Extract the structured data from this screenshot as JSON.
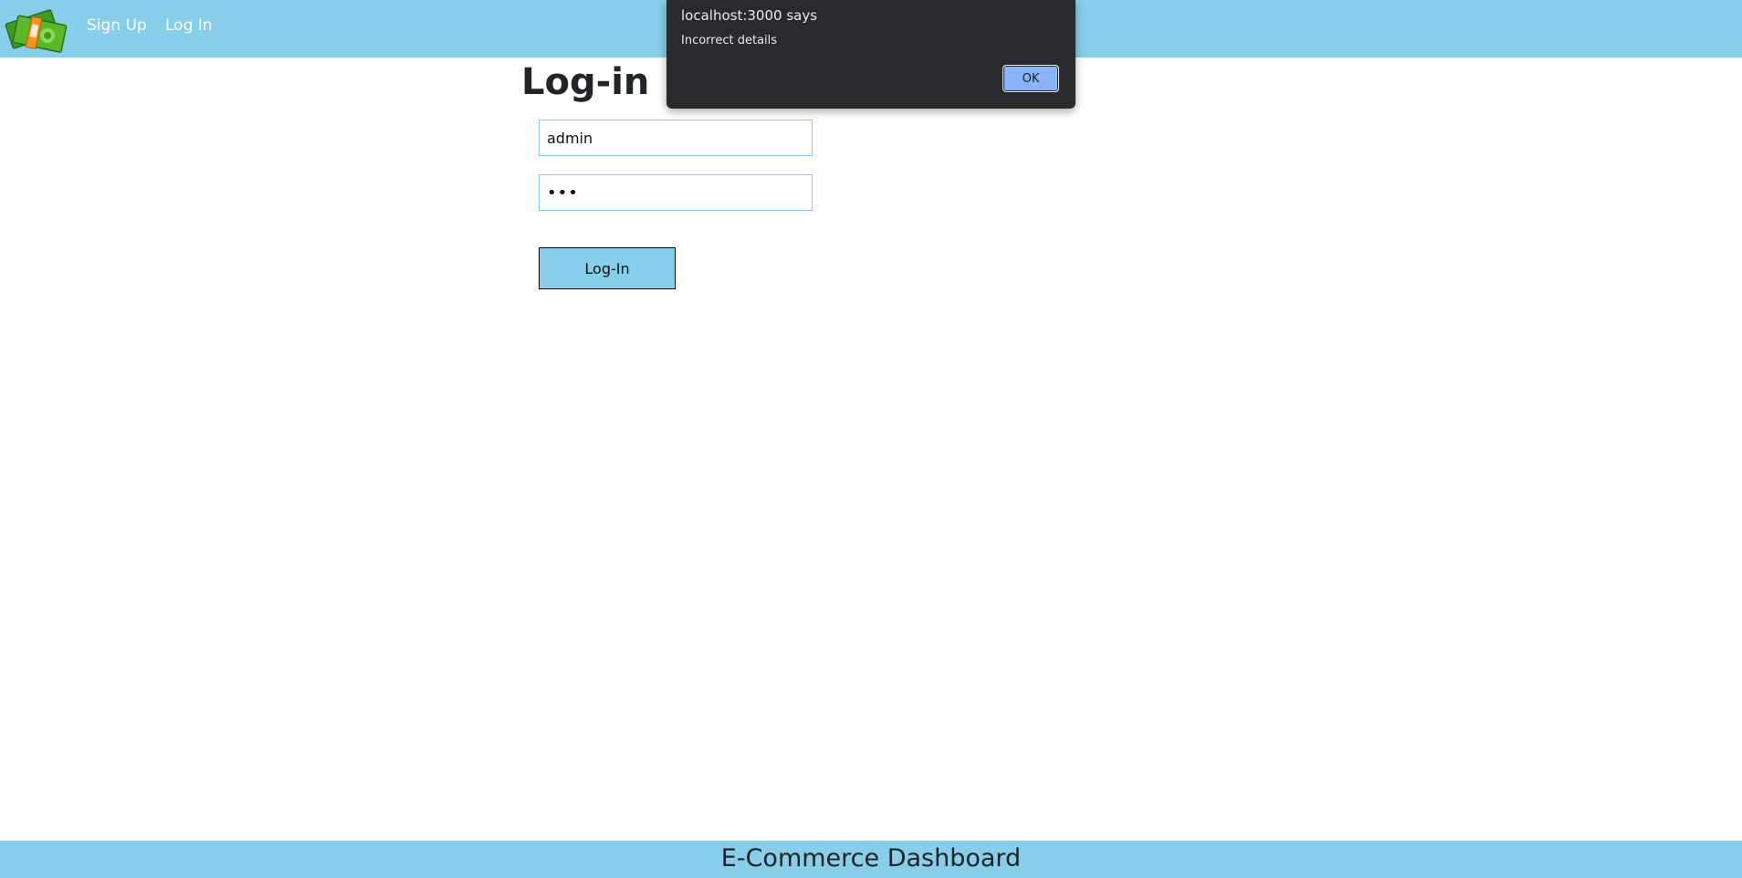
{
  "app": {
    "logo_icon": "money-bills-logo-icon"
  },
  "nav": {
    "items": [
      {
        "label": "Sign Up"
      },
      {
        "label": "Log In"
      }
    ]
  },
  "login_form": {
    "title": "Log-in",
    "username_value": "admin",
    "password_value": "•••",
    "submit_label": "Log-In"
  },
  "footer": {
    "title": "E-Commerce Dashboard"
  },
  "alert": {
    "origin": "localhost:3000 says",
    "message": "Incorrect details",
    "ok_label": "OK"
  },
  "colors": {
    "brand_bar": "#87ceeb",
    "dialog_bg": "#292a2d",
    "dialog_button": "#8ab4f8"
  }
}
